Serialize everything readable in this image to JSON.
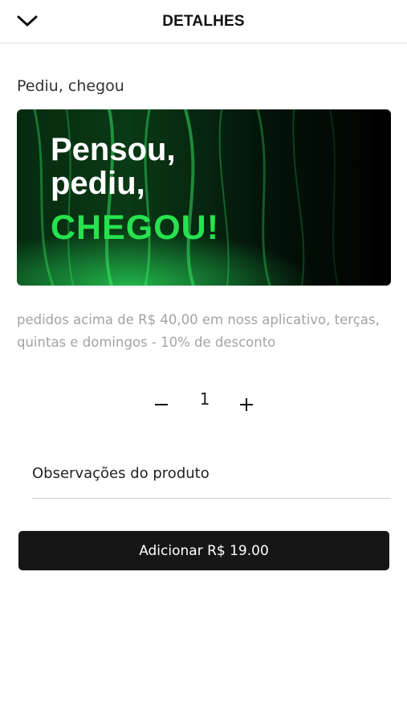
{
  "header": {
    "title": "DETALHES",
    "back_icon": "chevron-down-icon"
  },
  "product": {
    "name": "Pediu, chegou",
    "banner": {
      "line1": "Pensou,",
      "line2": "pediu,",
      "line3": "CHEGOU!",
      "accent_color": "#26e24f"
    },
    "description": "pedidos acima de R$ 40,00 em noss aplicativo, terças, quintas e domingos - 10% de desconto"
  },
  "quantity": {
    "value": "1",
    "minus_icon": "minus-icon",
    "plus_icon": "plus-icon"
  },
  "notes": {
    "placeholder": "Observações do produto"
  },
  "add_button": {
    "label": "Adicionar R$ 19.00"
  }
}
